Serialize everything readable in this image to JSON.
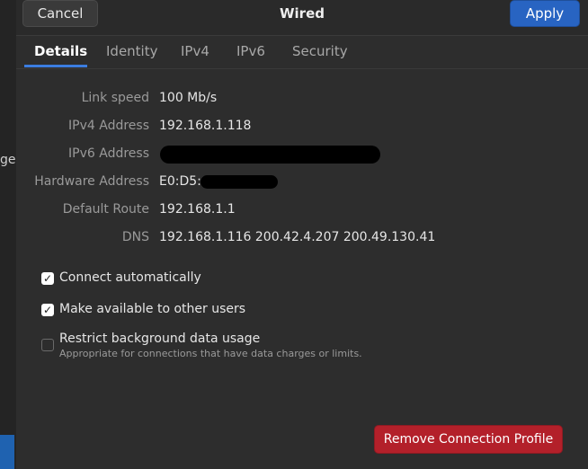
{
  "background": {
    "left_text": "ge"
  },
  "header": {
    "cancel_label": "Cancel",
    "title": "Wired",
    "apply_label": "Apply"
  },
  "tabs": [
    {
      "label": "Details"
    },
    {
      "label": "Identity"
    },
    {
      "label": "IPv4"
    },
    {
      "label": "IPv6"
    },
    {
      "label": "Security"
    }
  ],
  "details": {
    "link_speed": {
      "label": "Link speed",
      "value": "100 Mb/s"
    },
    "ipv4": {
      "label": "IPv4 Address",
      "value": "192.168.1.118"
    },
    "ipv6": {
      "label": "IPv6 Address",
      "value": ""
    },
    "hardware": {
      "label": "Hardware Address",
      "value": "E0:D5:"
    },
    "route": {
      "label": "Default Route",
      "value": "192.168.1.1"
    },
    "dns": {
      "label": "DNS",
      "value": "192.168.1.116 200.42.4.207 200.49.130.41"
    }
  },
  "options": {
    "connect_auto": {
      "label": "Connect automatically",
      "checked": true
    },
    "available_users": {
      "label": "Make available to other users",
      "checked": true
    },
    "restrict_bg": {
      "label": "Restrict background data usage",
      "sublabel": "Appropriate for connections that have data charges or limits.",
      "checked": false
    }
  },
  "footer": {
    "remove_label": "Remove Connection Profile"
  },
  "colors": {
    "accent": "#2864c2",
    "destructive": "#b3202a",
    "tab_indicator": "#3b7de0"
  }
}
